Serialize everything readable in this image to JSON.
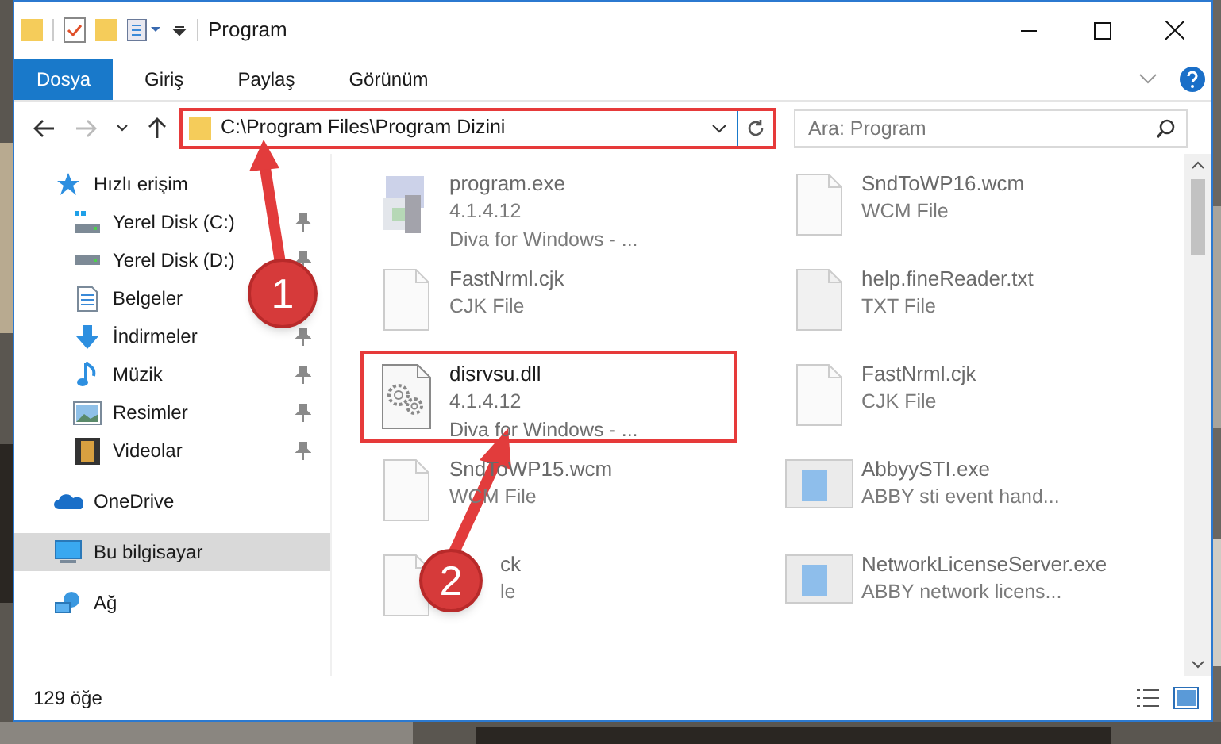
{
  "window": {
    "title": "Program"
  },
  "ribbon": {
    "tabs": [
      {
        "label": "Dosya",
        "selected": true
      },
      {
        "label": "Giriş",
        "selected": false
      },
      {
        "label": "Paylaş",
        "selected": false
      },
      {
        "label": "Görünüm",
        "selected": false
      }
    ]
  },
  "address_bar": {
    "path": "C:\\Program Files\\Program Dizini",
    "highlighted": true
  },
  "search": {
    "placeholder": "Ara: Program"
  },
  "sidebar": {
    "items": [
      {
        "label": "Hızlı erişim",
        "kind": "quick",
        "selected": false,
        "children": [
          {
            "label": "Yerel Disk (C:)",
            "kind": "drive-c",
            "pinned": true
          },
          {
            "label": "Yerel Disk (D:)",
            "kind": "drive",
            "pinned": true
          },
          {
            "label": "Belgeler",
            "kind": "documents"
          },
          {
            "label": "İndirmeler",
            "kind": "downloads",
            "pinned": true
          },
          {
            "label": "Müzik",
            "kind": "music",
            "pinned": true
          },
          {
            "label": "Resimler",
            "kind": "pictures",
            "pinned": true
          },
          {
            "label": "Videolar",
            "kind": "videos",
            "pinned": true
          }
        ]
      },
      {
        "label": "OneDrive",
        "kind": "cloud",
        "selected": false
      },
      {
        "label": "Bu bilgisayar",
        "kind": "computer",
        "selected": true
      },
      {
        "label": "Ağ",
        "kind": "network",
        "selected": false
      }
    ]
  },
  "files": [
    {
      "name": "program.exe",
      "lines": [
        "4.1.4.12",
        "Diva for Windows - ..."
      ],
      "kind": "app",
      "highlighted": false
    },
    {
      "name": "SndToWP16.wcm",
      "lines": [
        "WCM File"
      ],
      "kind": "document",
      "highlighted": false
    },
    {
      "name": "FastNrml.cjk",
      "lines": [
        "CJK File"
      ],
      "kind": "document",
      "highlighted": false
    },
    {
      "name": "help.fineReader.txt",
      "lines": [
        "TXT File"
      ],
      "kind": "text",
      "highlighted": false
    },
    {
      "name": "disrvsu.dll",
      "lines": [
        "4.1.4.12",
        "Diva for Windows - ..."
      ],
      "kind": "dll",
      "highlighted": true
    },
    {
      "name": "FastNrml.cjk",
      "lines": [
        "CJK File"
      ],
      "kind": "document",
      "highlighted": false
    },
    {
      "name": "SndToWP15.wcm",
      "lines": [
        "WCM File"
      ],
      "kind": "document",
      "highlighted": false
    },
    {
      "name": "AbbyySTI.exe",
      "lines": [
        "ABBY sti event hand..."
      ],
      "kind": "window",
      "highlighted": false
    },
    {
      "name": "ck",
      "lines": [
        "le"
      ],
      "kind": "document",
      "highlighted": false,
      "covered": true
    },
    {
      "name": "NetworkLicenseServer.exe",
      "lines": [
        "ABBY network licens..."
      ],
      "kind": "window",
      "highlighted": false
    }
  ],
  "status_bar": {
    "count": "129 öğe"
  },
  "steps": [
    {
      "label": "1"
    },
    {
      "label": "2"
    }
  ]
}
